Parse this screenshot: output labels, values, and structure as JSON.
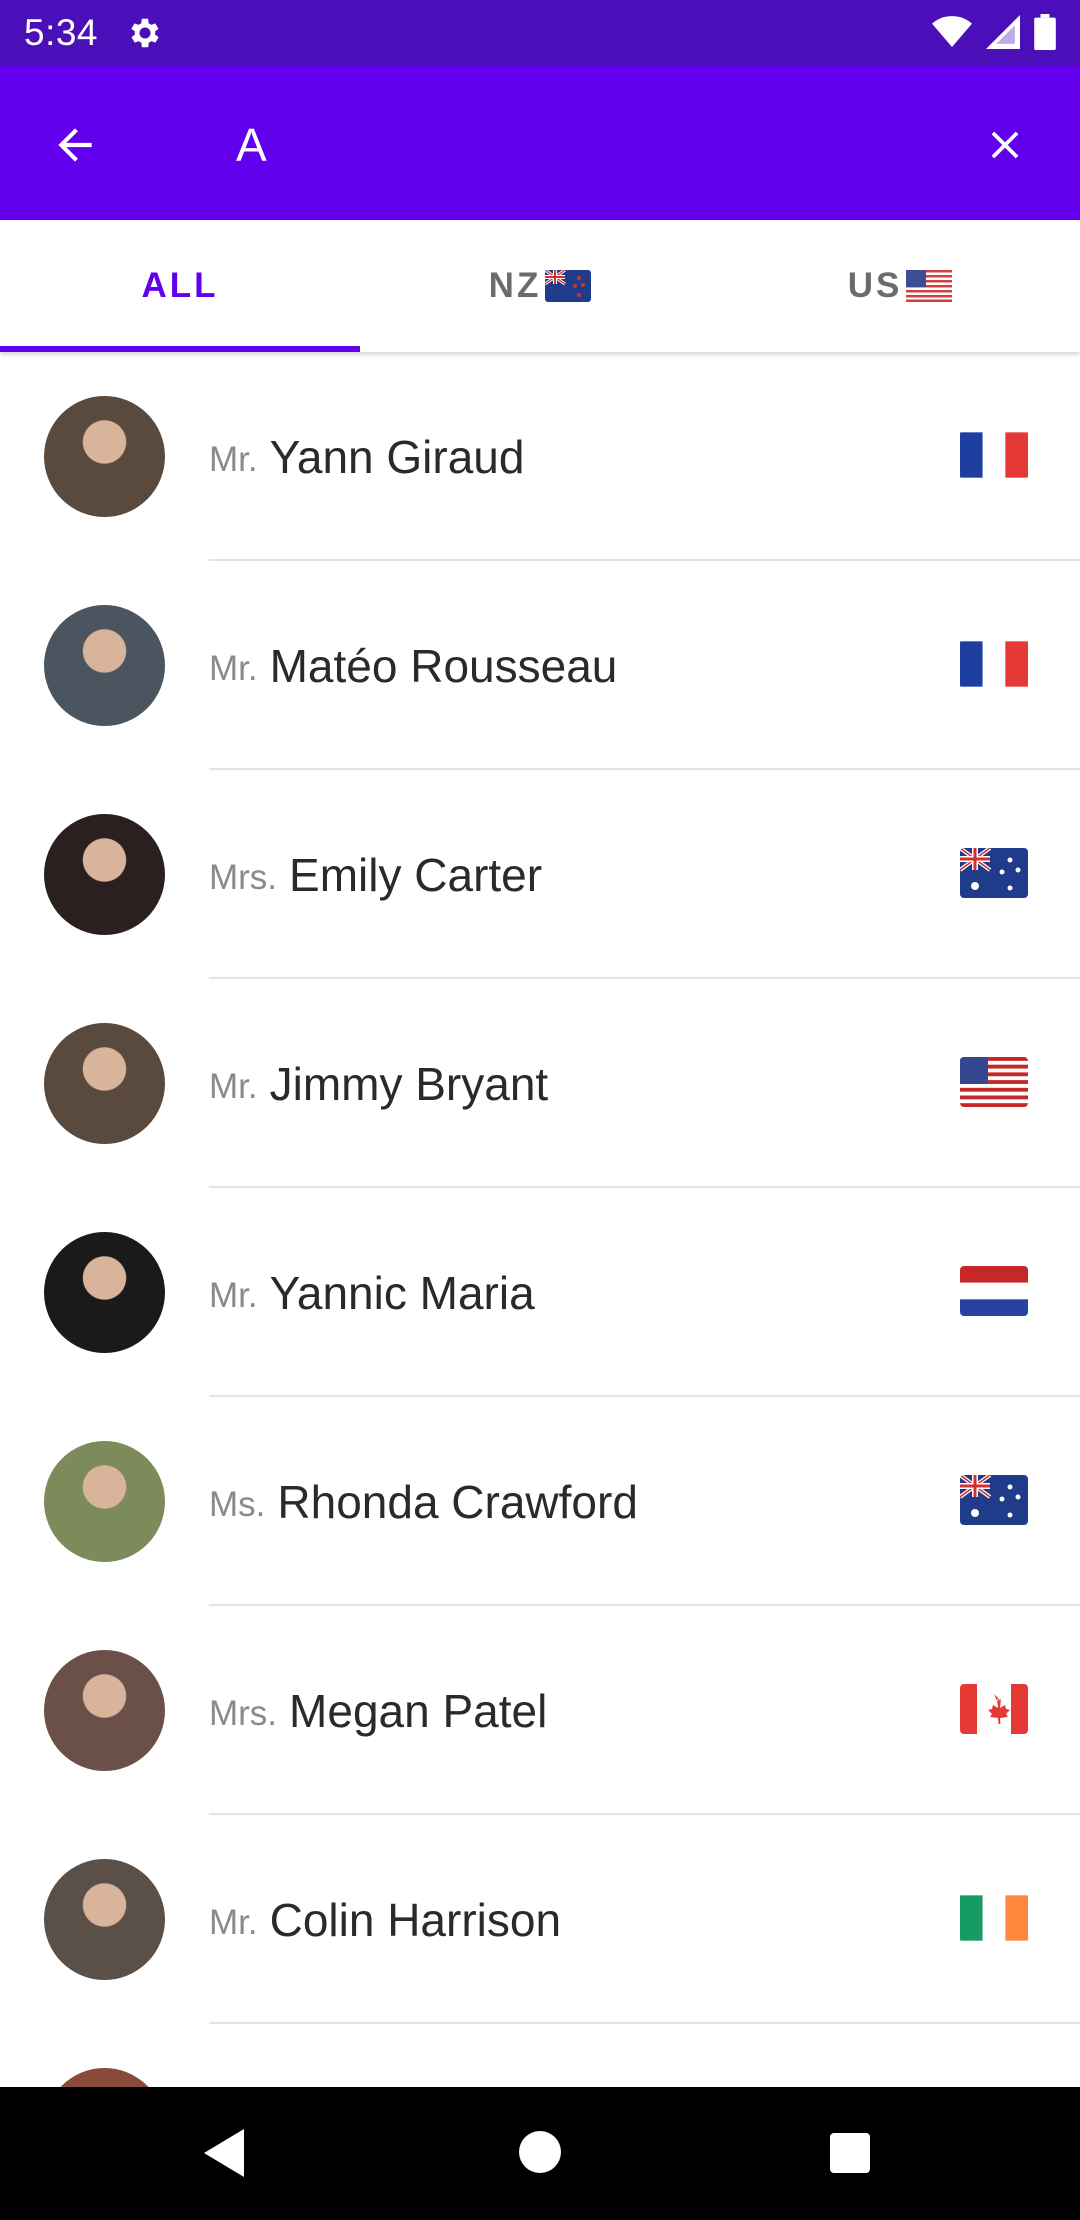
{
  "status_bar": {
    "time": "5:34",
    "icons": [
      "settings-gear-icon",
      "wifi-icon",
      "cell-signal-icon",
      "battery-icon"
    ]
  },
  "app_bar": {
    "color": "#6200ee",
    "search_value": "A"
  },
  "tabs": [
    {
      "label": "ALL",
      "flag": "",
      "active": true
    },
    {
      "label": "NZ",
      "flag": "nz",
      "active": false
    },
    {
      "label": "US",
      "flag": "us",
      "active": false
    }
  ],
  "contacts": [
    {
      "title": "Mr.",
      "name": "Yann Giraud",
      "flag": "fr",
      "avatar_bg": "#5a4a3e"
    },
    {
      "title": "Mr.",
      "name": "Matéo Rousseau",
      "flag": "fr",
      "avatar_bg": "#4a5560"
    },
    {
      "title": "Mrs.",
      "name": "Emily Carter",
      "flag": "au",
      "avatar_bg": "#2a2020"
    },
    {
      "title": "Mr.",
      "name": "Jimmy Bryant",
      "flag": "us",
      "avatar_bg": "#5a4a3e"
    },
    {
      "title": "Mr.",
      "name": "Yannic Maria",
      "flag": "nl",
      "avatar_bg": "#1a1a1a"
    },
    {
      "title": "Ms.",
      "name": "Rhonda Crawford",
      "flag": "au",
      "avatar_bg": "#7d8a5a"
    },
    {
      "title": "Mrs.",
      "name": "Megan Patel",
      "flag": "ca",
      "avatar_bg": "#6a5048"
    },
    {
      "title": "Mr.",
      "name": "Colin Harrison",
      "flag": "ie",
      "avatar_bg": "#5a5048"
    },
    {
      "title": "",
      "name": "",
      "flag": "",
      "avatar_bg": "#8a4a3a"
    }
  ]
}
